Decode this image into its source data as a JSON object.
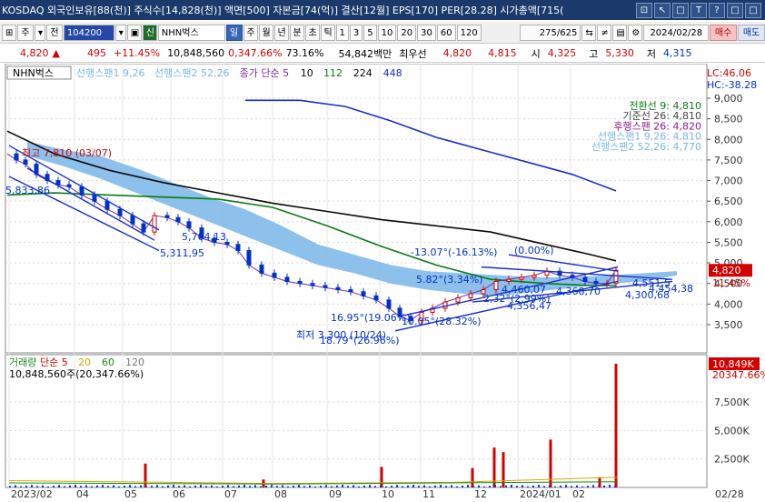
{
  "title": {
    "text": "KOSDAQ 외국인보유[88(천)] 주식수[14,828(천)] 액면[500] 자본금[74(억)] 결산[12월] EPS[170] PER[28.28] 시가총액[715(",
    "buttons": [
      "⊡",
      "↖",
      "□",
      "T",
      "?",
      "□",
      "□"
    ]
  },
  "toolbar": {
    "items": [
      "주",
      "▾",
      "전",
      "104200",
      "▾",
      "▣",
      "신",
      "NHN벅스",
      "일",
      "주",
      "월",
      "년",
      "분",
      "초",
      "틱",
      "1",
      "3",
      "5",
      "10",
      "20",
      "30",
      "60",
      "120"
    ],
    "count": "275",
    "total": "/625",
    "date": "2024/02/28",
    "buy_label": "매수",
    "sell_label": "매도"
  },
  "quote": {
    "price": "4,820",
    "arrow": "▲",
    "change": "495",
    "change_pct": "+11.45%",
    "volume": "10,848,560",
    "vol_pct": "0,347.66%",
    "turnover": "73.16%",
    "amount": "54,842백만",
    "best_label": "최우선",
    "best_ask": "4,820",
    "best_bid": "4,815",
    "open_label": "시",
    "open": "4,325",
    "high_label": "고",
    "high": "5,330",
    "low_label": "저",
    "low": "4,315"
  },
  "price_panel": {
    "stock_name": "NHN벅스",
    "legend": [
      {
        "label": "선행스팬1 9,26",
        "color": "#79b6e8"
      },
      {
        "label": "선행스팬2 52,26",
        "color": "#79b6e8"
      },
      {
        "label": "종가 단순 5",
        "color": "#7b2aa8"
      },
      {
        "label": "10",
        "color": "#0a0a0a"
      },
      {
        "label": "112",
        "color": "#0a7a14"
      },
      {
        "label": "224",
        "color": "#0a0a0a"
      },
      {
        "label": "448",
        "color": "#1a2fc8"
      }
    ],
    "lc": "LC:46.06",
    "hc": "HC:-38.28",
    "ichimoku_info": [
      {
        "label": "전환선 9: 4,810",
        "color": "#0a7a14"
      },
      {
        "label": "기준선 26: 4,810",
        "color": "#444444"
      },
      {
        "label": "후행스팬 26: 4,820",
        "color": "#8a1a8a"
      },
      {
        "label": "선행스팬1 9,26: 4,810",
        "color": "#79b6e8"
      },
      {
        "label": "선행스팬2 52,26: 4,770",
        "color": "#79b6e8"
      }
    ],
    "y_ticks": [
      "9,000",
      "8,500",
      "8,000",
      "7,500",
      "7,000",
      "6,500",
      "6,000",
      "5,500",
      "5,000",
      "4,500",
      "4,000",
      "3,500"
    ],
    "current_price": "4,820",
    "current_pct": "11.45%",
    "annotations": [
      {
        "text": "최고 7,810 (03/07)",
        "color": "#d40000"
      },
      {
        "text": "5,833,86",
        "color": "#0032c8"
      },
      {
        "text": "5,704,13",
        "color": "#0032c8"
      },
      {
        "text": "5,311,95",
        "color": "#0032c8"
      },
      {
        "text": "-13.07°(-16.13%)",
        "color": "#0032c8"
      },
      {
        "text": "(0.00%)",
        "color": "#0032c8"
      },
      {
        "text": "5.82°(3.34%)",
        "color": "#0032c8"
      },
      {
        "text": "2,32°(2.99%)",
        "color": "#0032c8"
      },
      {
        "text": "4,460,07",
        "color": "#0032c8"
      },
      {
        "text": "4,356,47",
        "color": "#0032c8"
      },
      {
        "text": "4,368,70",
        "color": "#0032c8"
      },
      {
        "text": "4,551,5",
        "color": "#0032c8"
      },
      {
        "text": "4,454,38",
        "color": "#0032c8"
      },
      {
        "text": "4,300,68",
        "color": "#0032c8"
      },
      {
        "text": "16.95°(19.06%)",
        "color": "#0032c8"
      },
      {
        "text": "10.05°(28.32%)",
        "color": "#0032c8"
      },
      {
        "text": "최저 3,300 (10/24)",
        "color": "#0032c8"
      },
      {
        "text": "18.79°(26.96%)",
        "color": "#0032c8"
      }
    ]
  },
  "volume_panel": {
    "legend": [
      {
        "label": "거래량",
        "color": "#1a8a1a"
      },
      {
        "label": "단순 5",
        "color": "#d40000"
      },
      {
        "label": "20",
        "color": "#d8a800"
      },
      {
        "label": "60",
        "color": "#1a8a1a"
      },
      {
        "label": "120",
        "color": "#777777"
      }
    ],
    "value_text": "10,848,560주(20,347.66%)",
    "y_ticks": [
      "7,500K",
      "5,000K",
      "2,500K"
    ],
    "current": "10,849K",
    "current_pct": "20347.66%"
  },
  "x_axis": {
    "labels": [
      "2023/02",
      "04",
      "05",
      "06",
      "07",
      "08",
      "09",
      "10",
      "11",
      "12",
      "2024/01",
      "02"
    ],
    "end_label": "02/28"
  },
  "colors": {
    "up": "#d40000",
    "down": "#0032c8",
    "title_bg": "#1b3a6b",
    "cloud": "#79b6e8"
  }
}
